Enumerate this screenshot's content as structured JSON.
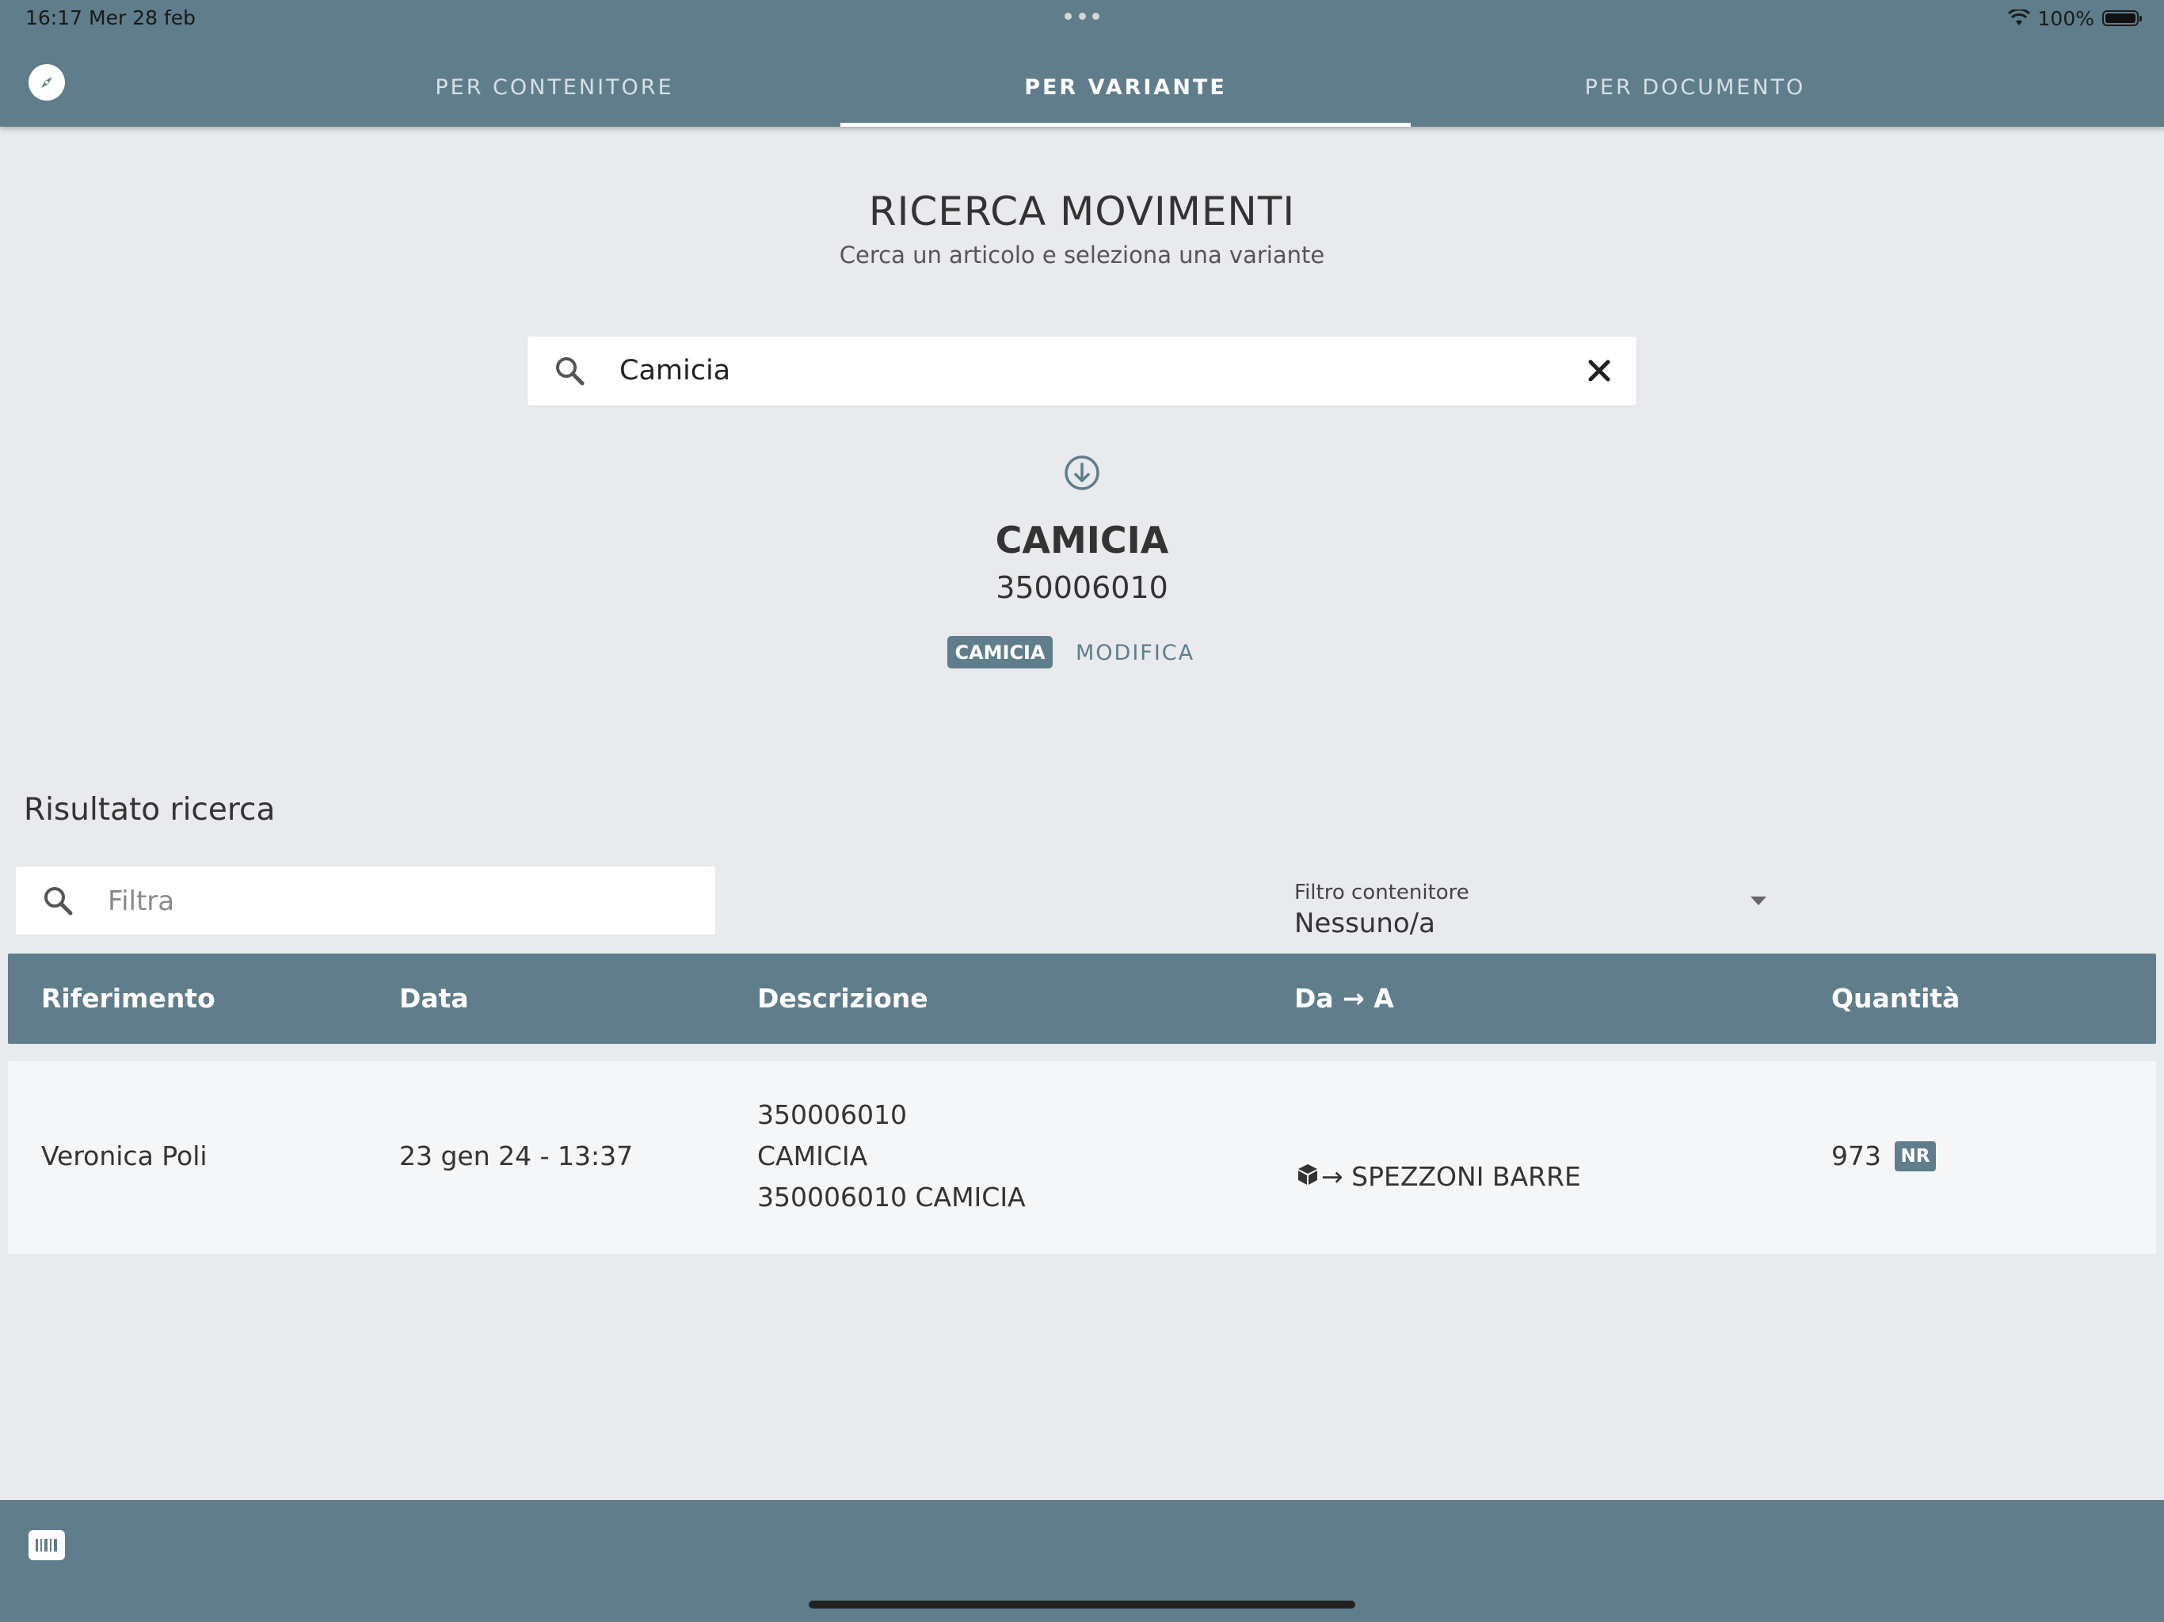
{
  "status_bar": {
    "time": "16:17",
    "date": "Mer 28 feb",
    "battery": "100%"
  },
  "tabs": [
    {
      "label": "PER CONTENITORE",
      "active": false
    },
    {
      "label": "PER VARIANTE",
      "active": true
    },
    {
      "label": "PER DOCUMENTO",
      "active": false
    }
  ],
  "header": {
    "title": "RICERCA MOVIMENTI",
    "subtitle": "Cerca un articolo e seleziona una variante"
  },
  "search": {
    "value": "Camicia"
  },
  "article": {
    "name": "CAMICIA",
    "code": "350006010",
    "chip": "CAMICIA",
    "edit_label": "MODIFICA"
  },
  "results": {
    "title": "Risultato ricerca",
    "filter_placeholder": "Filtra",
    "container_filter": {
      "label": "Filtro contenitore",
      "value": "Nessuno/a"
    },
    "columns": [
      "Riferimento",
      "Data",
      "Descrizione",
      "Da → A",
      "Quantità"
    ],
    "rows": [
      {
        "riferimento": "Veronica Poli",
        "data": "23 gen 24 - 13:37",
        "descrizione": [
          "350006010",
          "CAMICIA",
          "350006010 CAMICIA"
        ],
        "da_a": "→ SPEZZONI BARRE",
        "quantita": "973",
        "badge": "NR"
      }
    ]
  },
  "colors": {
    "primary": "#607d8b",
    "background": "#e8eaed",
    "row": "#f5f6f8"
  },
  "icons": [
    "compass-icon",
    "search-icon",
    "close-icon",
    "arrow-down-circle-icon",
    "box-icon",
    "barcode-icon"
  ]
}
